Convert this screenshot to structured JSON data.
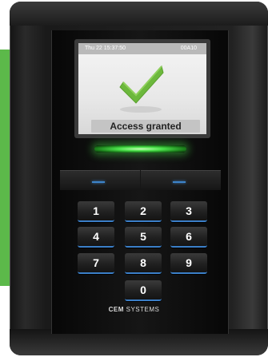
{
  "screen": {
    "datetime": "Thu 22 15:37:50",
    "device_id": "00A10",
    "message": "Access granted"
  },
  "keypad": {
    "keys": [
      "1",
      "2",
      "3",
      "4",
      "5",
      "6",
      "7",
      "8",
      "9",
      "0"
    ]
  },
  "brand": {
    "name_bold": "CEM",
    "name_rest": " SYSTEMS"
  },
  "colors": {
    "wall_panel": "#5cb94a",
    "led": "#4be24b",
    "key_accent": "#3b7fc8",
    "checkmark": "#6cb83c"
  },
  "icons": {
    "status": "checkmark-icon"
  }
}
